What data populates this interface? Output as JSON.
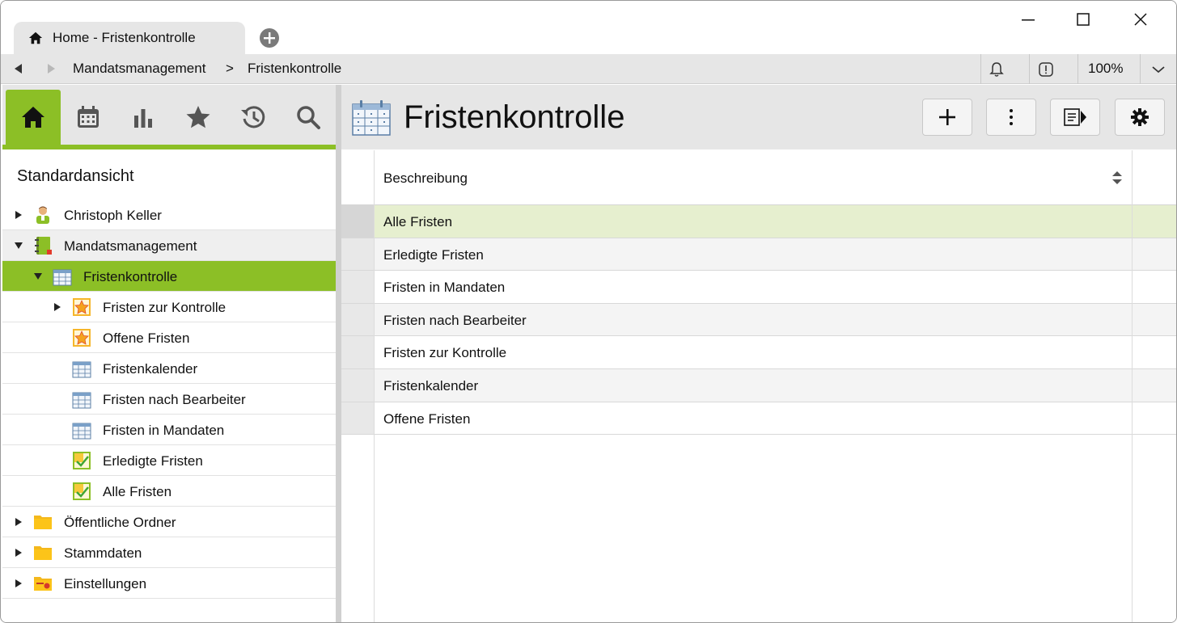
{
  "tab": {
    "title": "Home - Fristenkontrolle"
  },
  "breadcrumb": {
    "items": [
      "Mandatsmanagement",
      "Fristenkontrolle"
    ],
    "separator": ">"
  },
  "zoom": "100%",
  "left_panel": {
    "title": "Standardansicht",
    "tools": [
      "home-icon",
      "calendar-icon",
      "chart-icon",
      "star-icon",
      "history-icon",
      "search-icon"
    ],
    "tree": [
      {
        "label": "Christoph Keller",
        "icon": "person-icon",
        "expand": "collapsed",
        "level": 0
      },
      {
        "label": "Mandatsmanagement",
        "icon": "binder-icon",
        "expand": "expanded",
        "level": 0
      },
      {
        "label": "Fristenkontrolle",
        "icon": "calendar-grid-icon",
        "expand": "expanded",
        "level": 1,
        "selected": true
      },
      {
        "label": "Fristen zur Kontrolle",
        "icon": "star-folder-icon",
        "expand": "collapsed",
        "level": 2
      },
      {
        "label": "Offene Fristen",
        "icon": "star-folder-icon",
        "expand": "none",
        "level": 2
      },
      {
        "label": "Fristenkalender",
        "icon": "calendar-grid-icon",
        "expand": "none",
        "level": 2
      },
      {
        "label": "Fristen nach Bearbeiter",
        "icon": "calendar-grid-icon",
        "expand": "none",
        "level": 2
      },
      {
        "label": "Fristen in Mandaten",
        "icon": "calendar-grid-icon",
        "expand": "none",
        "level": 2
      },
      {
        "label": "Erledigte Fristen",
        "icon": "check-folder-icon",
        "expand": "none",
        "level": 2
      },
      {
        "label": "Alle Fristen",
        "icon": "check-folder-icon",
        "expand": "none",
        "level": 2
      },
      {
        "label": "Öffentliche Ordner",
        "icon": "folder-icon",
        "expand": "collapsed",
        "level": 0
      },
      {
        "label": "Stammdaten",
        "icon": "folder-icon",
        "expand": "collapsed",
        "level": 0
      },
      {
        "label": "Einstellungen",
        "icon": "settings-folder-icon",
        "expand": "collapsed",
        "level": 0
      }
    ]
  },
  "main": {
    "title": "Fristenkontrolle",
    "toolbar": [
      "add-icon",
      "more-icon",
      "panel-toggle-icon",
      "settings-icon"
    ],
    "column_header": "Beschreibung",
    "rows": [
      "Alle Fristen",
      "Erledigte Fristen",
      "Fristen in Mandaten",
      "Fristen nach Bearbeiter",
      "Fristen zur Kontrolle",
      "Fristenkalender",
      "Offene Fristen"
    ]
  },
  "colors": {
    "accent": "#8cbf26",
    "highlight_row": "#e6efcf",
    "chrome": "#e6e6e6"
  }
}
